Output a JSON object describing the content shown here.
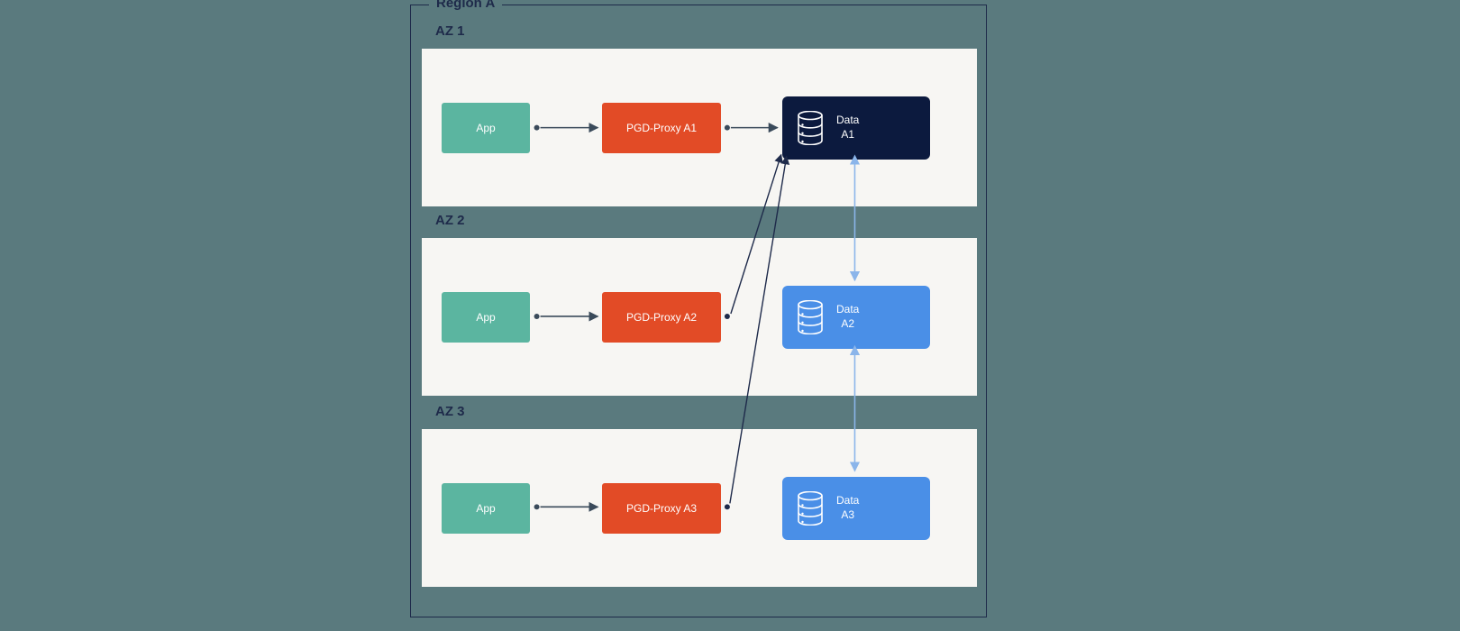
{
  "region": {
    "label": "Region A"
  },
  "zones": [
    {
      "key": "az1",
      "label": "AZ 1",
      "app_label": "App",
      "proxy_label": "PGD-Proxy A1",
      "data_label": "Data\nA1",
      "data_role": "primary"
    },
    {
      "key": "az2",
      "label": "AZ 2",
      "app_label": "App",
      "proxy_label": "PGD-Proxy A2",
      "data_label": "Data\nA2",
      "data_role": "replica"
    },
    {
      "key": "az3",
      "label": "AZ 3",
      "app_label": "App",
      "proxy_label": "PGD-Proxy A3",
      "data_label": "Data\nA3",
      "data_role": "replica"
    }
  ],
  "colors": {
    "app": "#5bb5a0",
    "proxy": "#e24b26",
    "data_primary": "#0c1a3e",
    "data_replica": "#4a8fe7",
    "border_dark": "#1e2a4a",
    "background": "#5a7a7e",
    "panel": "#f7f6f3",
    "link_arrow": "#3a4a5a",
    "link_bidir": "#8bb5ea"
  },
  "flows": {
    "intra_zone": [
      {
        "from": "app",
        "to": "proxy"
      },
      {
        "from": "proxy",
        "to": "data_primary",
        "zone": "az1"
      }
    ],
    "cross_zone_to_primary": [
      {
        "from": "proxy_az2",
        "to": "data_az1"
      },
      {
        "from": "proxy_az3",
        "to": "data_az1"
      }
    ],
    "bidirectional_replication": [
      {
        "between": [
          "data_az1",
          "data_az2"
        ]
      },
      {
        "between": [
          "data_az2",
          "data_az3"
        ]
      }
    ]
  }
}
